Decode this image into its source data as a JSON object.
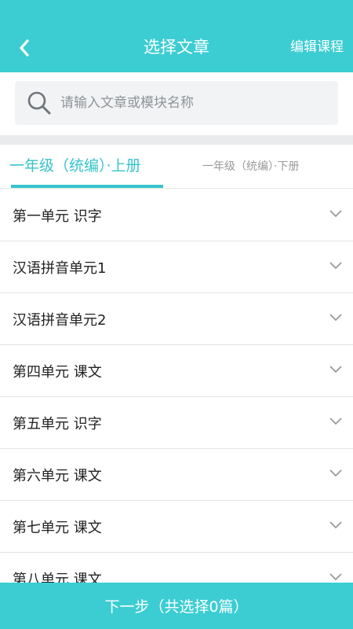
{
  "header": {
    "title": "选择文章",
    "edit_label": "编辑课程"
  },
  "search": {
    "placeholder": "请输入文章或模块名称"
  },
  "tabs": [
    {
      "label": "一年级（统编）·上册",
      "active": true
    },
    {
      "label": "一年级（统编）·下册",
      "active": false
    }
  ],
  "units": [
    {
      "label": "第一单元 识字"
    },
    {
      "label": "汉语拼音单元1"
    },
    {
      "label": "汉语拼音单元2"
    },
    {
      "label": "第四单元 课文"
    },
    {
      "label": "第五单元 识字"
    },
    {
      "label": "第六单元 课文"
    },
    {
      "label": "第七单元 课文"
    },
    {
      "label": "第八单元 课文"
    }
  ],
  "footer": {
    "next_label": "下一步（共选择0篇）"
  },
  "colors": {
    "accent": "#3ccdd3",
    "tab_active": "#37c4ca",
    "divider": "#e9ebed"
  }
}
